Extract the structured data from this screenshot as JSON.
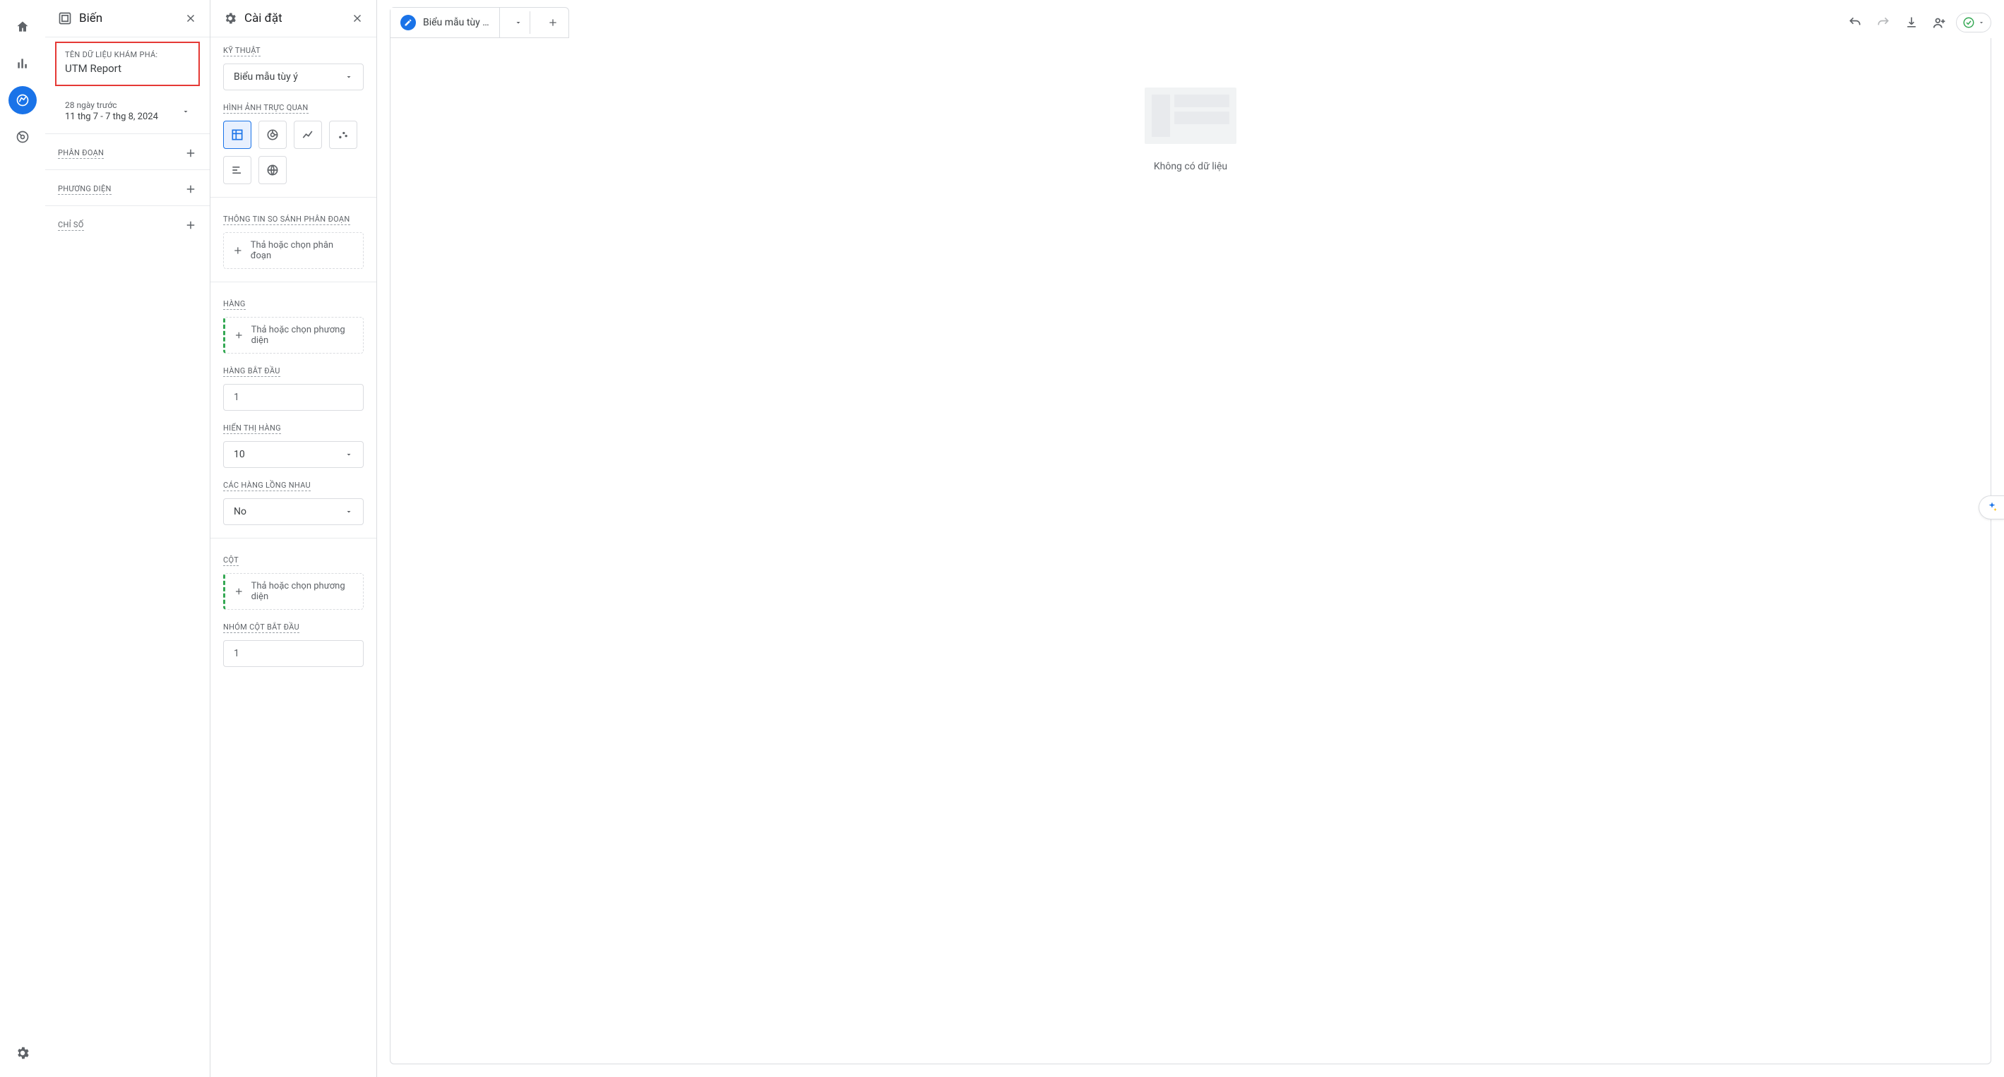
{
  "rail": {
    "home": "home",
    "reports": "reports",
    "explore": "explore",
    "advertising": "advertising",
    "admin": "admin"
  },
  "variables": {
    "title": "Biến",
    "name_label": "TÊN DỮ LIỆU KHÁM PHÁ:",
    "name_value": "UTM Report",
    "date_preset": "28 ngày trước",
    "date_range": "11 thg 7 - 7 thg 8, 2024",
    "segments_label": "PHÂN ĐOẠN",
    "dimensions_label": "PHƯƠNG DIỆN",
    "metrics_label": "CHỈ SỐ"
  },
  "settings": {
    "title": "Cài đặt",
    "technique_label": "KỸ THUẬT",
    "technique_value": "Biểu mẫu tùy ý",
    "visualization_label": "HÌNH ẢNH TRỰC QUAN",
    "segment_compare_label": "THÔNG TIN SO SÁNH PHÂN ĐOẠN",
    "segment_drop": "Thả hoặc chọn phân đoạn",
    "rows_label": "HÀNG",
    "rows_drop": "Thả hoặc chọn phương diện",
    "row_start_label": "HÀNG BẮT ĐẦU",
    "row_start_value": "1",
    "show_rows_label": "HIỂN THỊ HÀNG",
    "show_rows_value": "10",
    "nested_rows_label": "CÁC HÀNG LỒNG NHAU",
    "nested_rows_value": "No",
    "columns_label": "CỘT",
    "columns_drop": "Thả hoặc chọn phương diện",
    "col_group_start_label": "NHÓM CỘT BẮT ĐẦU",
    "col_group_start_value": "1"
  },
  "main": {
    "tab_title": "Biểu mẫu tùy …",
    "empty_text": "Không có dữ liệu"
  }
}
